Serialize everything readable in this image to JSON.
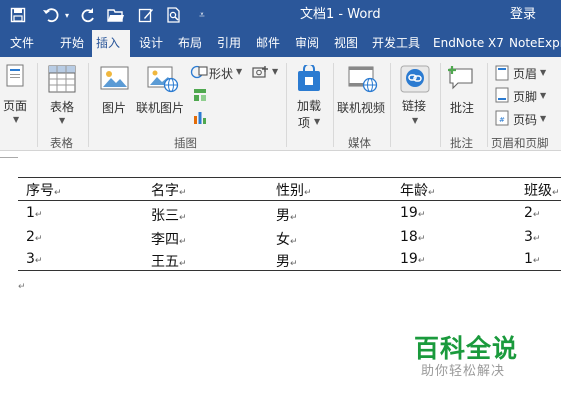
{
  "titlebar": {
    "doc_title": "文档1 - Word",
    "login": "登录",
    "qat": [
      "save-icon",
      "undo-icon",
      "redo-icon",
      "open-icon",
      "edit-icon",
      "print-preview-icon",
      "customize-icon"
    ]
  },
  "tabs": [
    "文件",
    "开始",
    "插入",
    "设计",
    "布局",
    "引用",
    "邮件",
    "审阅",
    "视图",
    "开发工具",
    "EndNote X7",
    "NoteExpre"
  ],
  "active_tab": "插入",
  "ribbon": {
    "pages": {
      "label": "页面",
      "group": ""
    },
    "table": {
      "label": "表格",
      "group": "表格"
    },
    "illustrations": {
      "picture": "图片",
      "online_picture": "联机图片",
      "shapes": "形状",
      "group": "插图"
    },
    "addins": {
      "label": "加载\n项",
      "line1": "加载",
      "line2": "项"
    },
    "media": {
      "label": "联机视频",
      "group": "媒体"
    },
    "links": {
      "label": "链接"
    },
    "comments": {
      "label": "批注",
      "group": "批注"
    },
    "header_footer": {
      "header": "页眉",
      "footer": "页脚",
      "page_number": "页码",
      "group": "页眉和页脚"
    }
  },
  "table": {
    "headers": [
      "序号",
      "名字",
      "性别",
      "年龄",
      "班级"
    ],
    "rows": [
      [
        "1",
        "张三",
        "男",
        "19",
        "2"
      ],
      [
        "2",
        "李四",
        "女",
        "18",
        "3"
      ],
      [
        "3",
        "王五",
        "男",
        "19",
        "1"
      ]
    ]
  },
  "watermark": {
    "main": "百科全说",
    "sub": "助你轻松解决"
  },
  "colors": {
    "word_blue": "#2b579a",
    "ribbon_bg": "#f3f3f3",
    "watermark_green": "#1a9a3c"
  }
}
